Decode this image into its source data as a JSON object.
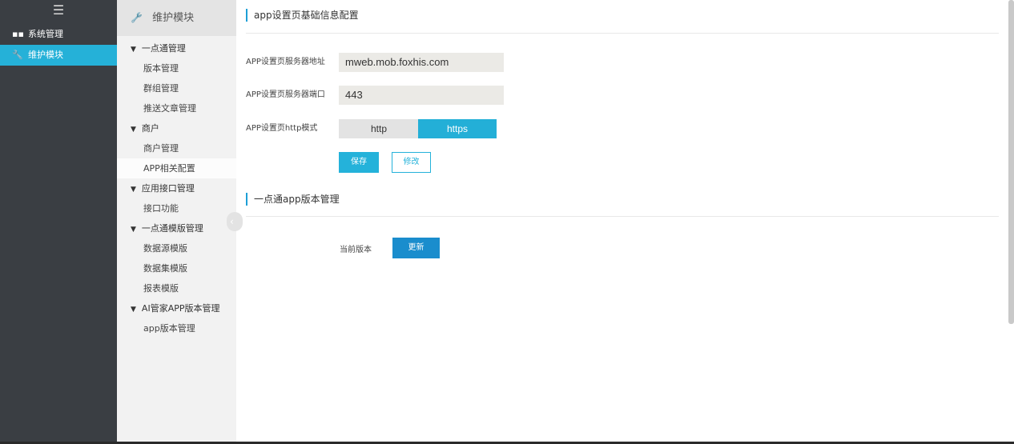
{
  "leftnav": {
    "menu_icon": "hamburger-icon",
    "items": [
      {
        "label": "系统管理",
        "icon": "grid-icon",
        "active": false
      },
      {
        "label": "维护模块",
        "icon": "wrench-icon",
        "active": true
      }
    ]
  },
  "subnav": {
    "title": "维护模块",
    "title_icon": "wrench-icon",
    "groups": [
      {
        "label": "一点通管理",
        "items": [
          "版本管理",
          "群组管理",
          "推送文章管理"
        ]
      },
      {
        "label": "商户",
        "items": [
          "商户管理",
          "APP相关配置"
        ]
      },
      {
        "label": "应用接口管理",
        "items": [
          "接口功能"
        ]
      },
      {
        "label": "一点通模版管理",
        "items": [
          "数据源模版",
          "数据集模版",
          "报表模版"
        ]
      },
      {
        "label": "AI管家APP版本管理",
        "items": [
          "app版本管理"
        ]
      }
    ],
    "selected": "APP相关配置",
    "collapse_glyph": "‹"
  },
  "config": {
    "title": "app设置页基础信息配置",
    "server_address_label": "APP设置页服务器地址",
    "server_address_value": "mweb.mob.foxhis.com",
    "server_port_label": "APP设置页服务器端口",
    "server_port_value": "443",
    "http_mode_label": "APP设置页http模式",
    "http_option": "http",
    "https_option": "https",
    "selected_mode": "https",
    "save_label": "保存",
    "edit_label": "修改"
  },
  "version": {
    "title": "一点通app版本管理",
    "current_version_label": "当前版本",
    "update_label": "更新"
  },
  "colors": {
    "accent": "#23afd7",
    "nav_bg": "#3a3e43",
    "update_button": "#1a8dcd"
  }
}
